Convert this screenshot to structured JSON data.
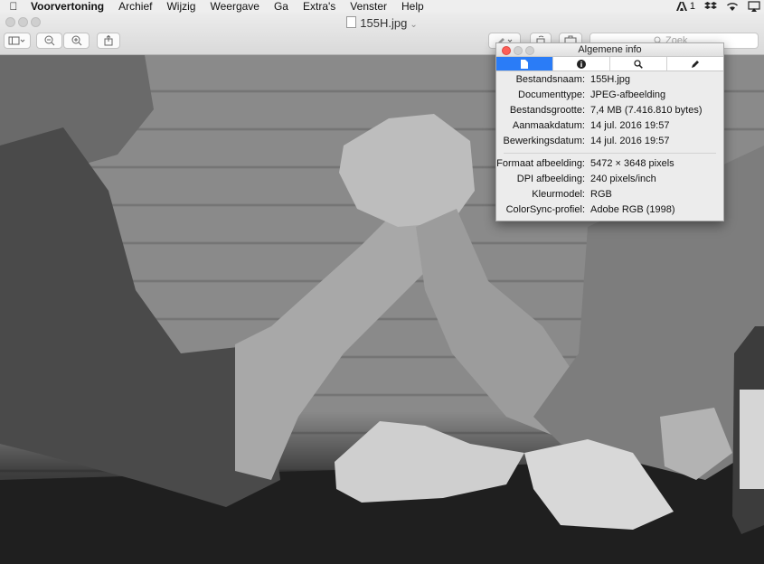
{
  "menubar": {
    "app_name": "Voorvertoning",
    "items": [
      "Archief",
      "Wijzig",
      "Weergave",
      "Ga",
      "Extra's",
      "Venster",
      "Help"
    ],
    "right_status": "1"
  },
  "window": {
    "title": "155H.jpg",
    "search_placeholder": "Zoek"
  },
  "inspector": {
    "title": "Algemene info",
    "rows": [
      {
        "label": "Bestandsnaam:",
        "value": "155H.jpg"
      },
      {
        "label": "Documenttype:",
        "value": "JPEG-afbeelding"
      },
      {
        "label": "Bestandsgrootte:",
        "value": "7,4 MB (7.416.810 bytes)"
      },
      {
        "label": "Aanmaakdatum:",
        "value": "14 jul. 2016 19:57"
      },
      {
        "label": "Bewerkingsdatum:",
        "value": "14 jul. 2016 19:57"
      },
      {
        "label": "Formaat afbeelding:",
        "value": "5472 × 3648 pixels"
      },
      {
        "label": "DPI afbeelding:",
        "value": "240 pixels/inch"
      },
      {
        "label": "Kleurmodel:",
        "value": "RGB"
      },
      {
        "label": "ColorSync-profiel:",
        "value": "Adobe RGB (1998)"
      }
    ],
    "tabs": [
      "document-icon",
      "info-icon",
      "magnifier-icon",
      "pencil-icon"
    ],
    "active_tab": 0
  },
  "colors": {
    "accent": "#2a7cf7",
    "close": "#fc5f57"
  }
}
